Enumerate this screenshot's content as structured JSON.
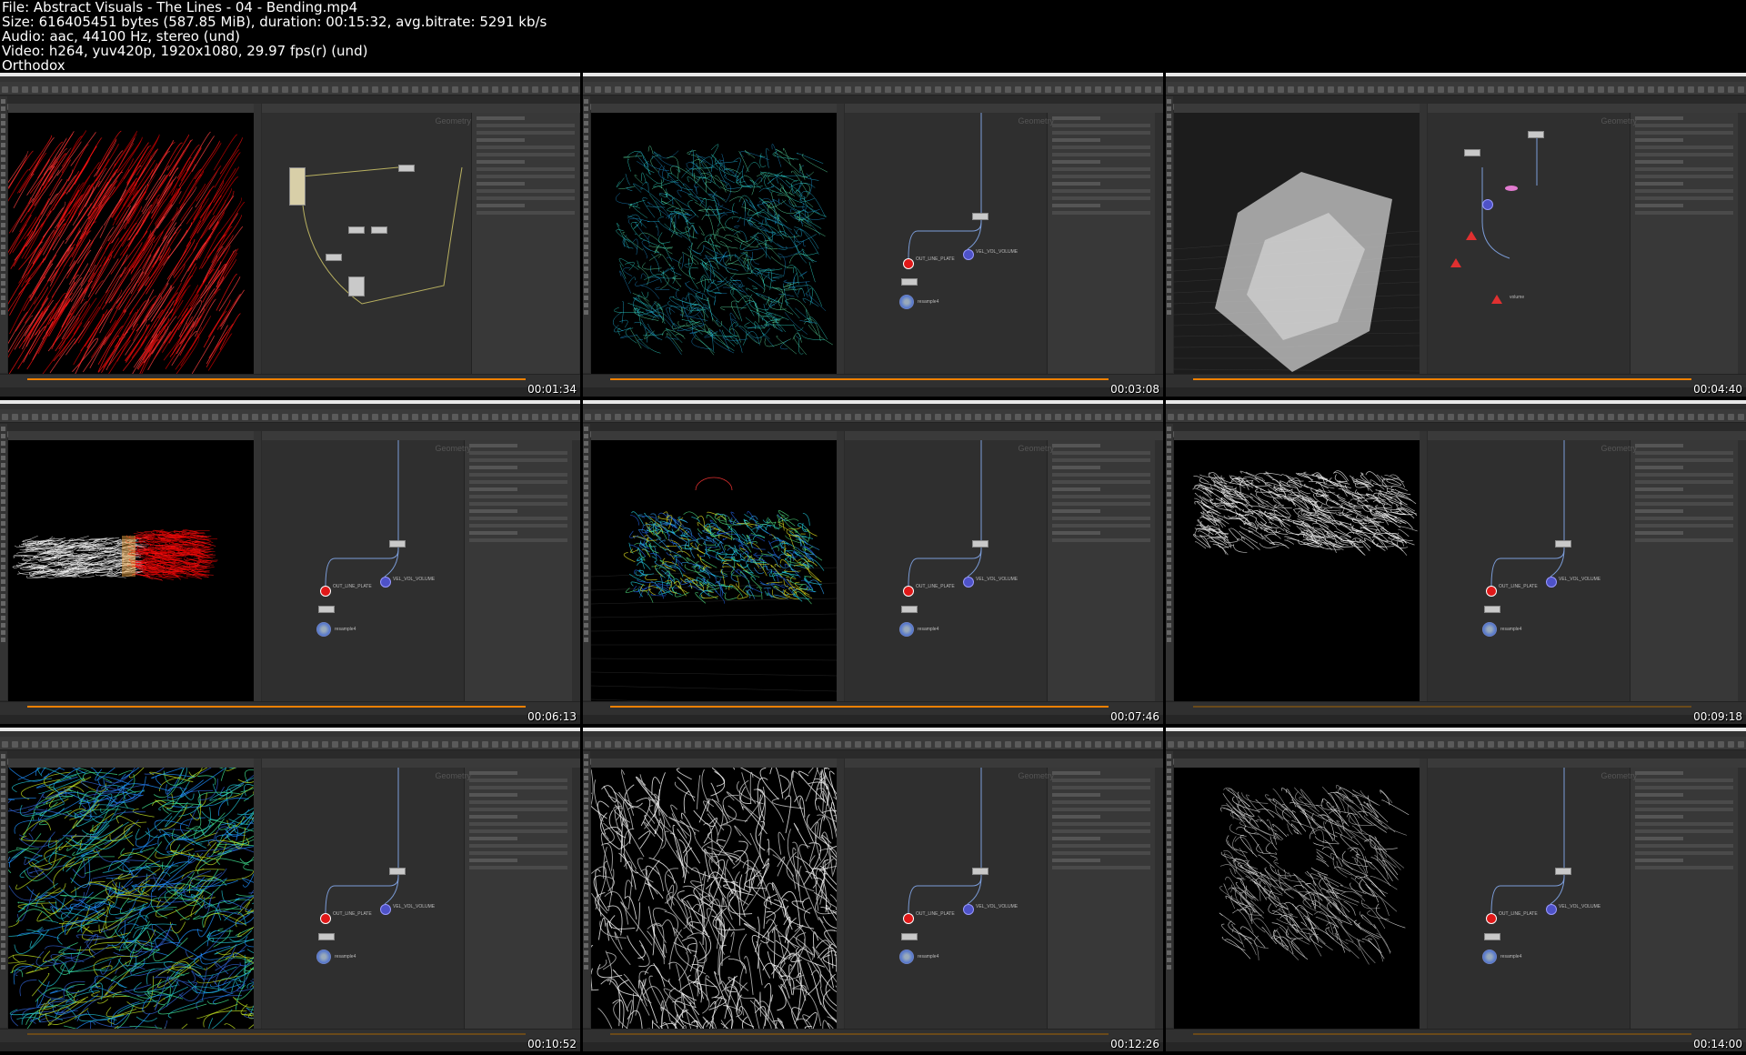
{
  "header": {
    "line1": "File: Abstract Visuals - The Lines - 04 - Bending.mp4",
    "line2": "Size: 616405451 bytes (587.85 MiB), duration: 00:15:32, avg.bitrate: 5291 kb/s",
    "line3": "Audio: aac, 44100 Hz, stereo (und)",
    "line4": "Video: h264, yuv420p, 1920x1080, 29.97 fps(r) (und)",
    "line5": "Orthodox"
  },
  "thumbnails": [
    {
      "timestamp": "00:01:34"
    },
    {
      "timestamp": "00:03:08"
    },
    {
      "timestamp": "00:04:40"
    },
    {
      "timestamp": "00:06:13"
    },
    {
      "timestamp": "00:07:46"
    },
    {
      "timestamp": "00:09:18"
    },
    {
      "timestamp": "00:10:52"
    },
    {
      "timestamp": "00:12:26"
    },
    {
      "timestamp": "00:14:00"
    }
  ],
  "node_labels": {
    "out_line_plate": "OUT_LINE_PLATE",
    "vel_volume": "VEL_VOL_VOLUME",
    "out_lines": "OUT_LINES",
    "resample": "resample4",
    "volume": "volume",
    "context": "Geometry"
  },
  "colors": {
    "accent_timeline": "#f08000",
    "node_null": "#e01818",
    "node_object": "#4e52c8",
    "node_merge": "#e27bd0"
  }
}
